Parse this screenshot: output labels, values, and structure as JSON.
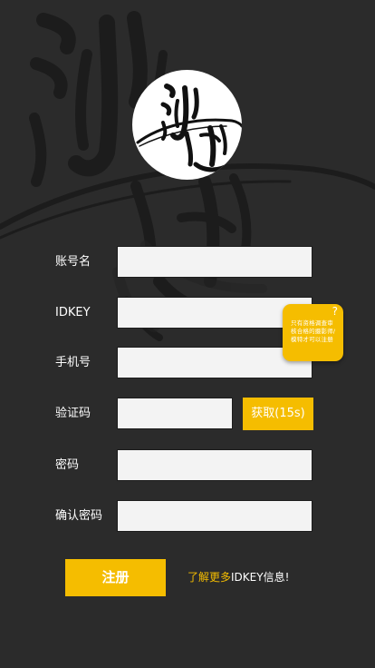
{
  "logo": {
    "calligraphy": "沙就"
  },
  "form": {
    "fields": [
      {
        "label": "账号名",
        "value": "",
        "placeholder": ""
      },
      {
        "label": "IDKEY",
        "value": "",
        "placeholder": ""
      },
      {
        "label": "手机号",
        "value": "",
        "placeholder": ""
      },
      {
        "label": "验证码",
        "value": "",
        "placeholder": ""
      },
      {
        "label": "密码",
        "value": "",
        "placeholder": ""
      },
      {
        "label": "确认密码",
        "value": "",
        "placeholder": ""
      }
    ],
    "code_button_label": "获取(15s)"
  },
  "tooltip": {
    "icon": "question-mark-icon",
    "icon_text": "?",
    "text": "只有资格调查审核合格的摄影师/模特才可以注册"
  },
  "actions": {
    "register_label": "注册",
    "more_prefix": "了解更多",
    "more_suffix": "IDKEY信息!"
  },
  "colors": {
    "background": "#2b2b2b",
    "accent": "#f5bd00",
    "input_bg": "#f3f3f3",
    "text": "#ffffff"
  }
}
